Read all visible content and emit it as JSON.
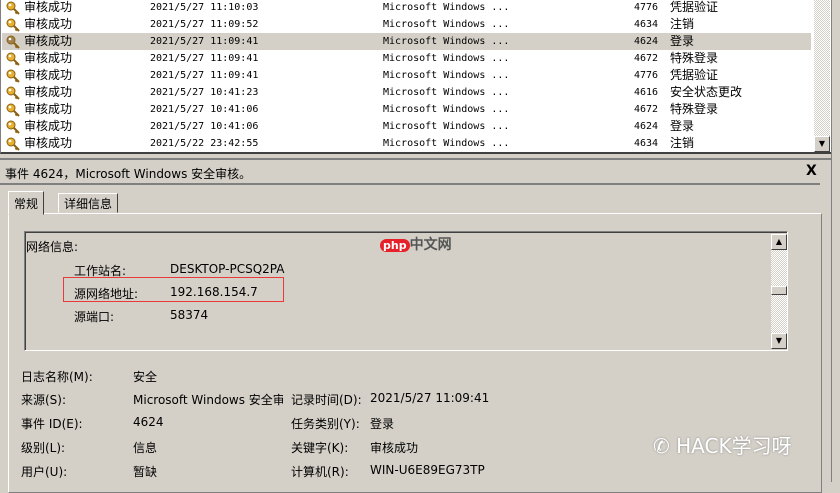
{
  "events": [
    {
      "level": "审核成功",
      "date": "2021/5/27 11:10:03",
      "source": "Microsoft Windows ...",
      "id": "4776",
      "task": "凭据验证"
    },
    {
      "level": "审核成功",
      "date": "2021/5/27 11:09:52",
      "source": "Microsoft Windows ...",
      "id": "4634",
      "task": "注销"
    },
    {
      "level": "审核成功",
      "date": "2021/5/27 11:09:41",
      "source": "Microsoft Windows ...",
      "id": "4624",
      "task": "登录"
    },
    {
      "level": "审核成功",
      "date": "2021/5/27 11:09:41",
      "source": "Microsoft Windows ...",
      "id": "4672",
      "task": "特殊登录"
    },
    {
      "level": "审核成功",
      "date": "2021/5/27 11:09:41",
      "source": "Microsoft Windows ...",
      "id": "4776",
      "task": "凭据验证"
    },
    {
      "level": "审核成功",
      "date": "2021/5/27 10:41:23",
      "source": "Microsoft Windows ...",
      "id": "4616",
      "task": "安全状态更改"
    },
    {
      "level": "审核成功",
      "date": "2021/5/27 10:41:06",
      "source": "Microsoft Windows ...",
      "id": "4672",
      "task": "特殊登录"
    },
    {
      "level": "审核成功",
      "date": "2021/5/27 10:41:06",
      "source": "Microsoft Windows ...",
      "id": "4624",
      "task": "登录"
    },
    {
      "level": "审核成功",
      "date": "2021/5/22 23:42:55",
      "source": "Microsoft Windows ...",
      "id": "4634",
      "task": "注销"
    }
  ],
  "detail": {
    "title": "事件 4624，Microsoft Windows 安全审核。",
    "close": "X",
    "tabs": [
      "常规",
      "详细信息"
    ],
    "network": {
      "heading": "网络信息:",
      "workstation_label": "工作站名:",
      "workstation": "DESKTOP-PCSQ2PA",
      "addr_label": "源网络地址:",
      "addr": "192.168.154.7",
      "port_label": "源端口:",
      "port": "58374"
    },
    "fields": {
      "log_label": "日志名称(M):",
      "log": "安全",
      "source_label": "来源(S):",
      "source": "Microsoft Windows 安全审",
      "logged_label": "记录时间(D):",
      "logged": "2021/5/27 11:09:41",
      "eventid_label": "事件 ID(E):",
      "eventid": "4624",
      "task_label": "任务类别(Y):",
      "task": "登录",
      "level_label": "级别(L):",
      "level": "信息",
      "keywords_label": "关键字(K):",
      "keywords": "审核成功",
      "user_label": "用户(U):",
      "user": "暂缺",
      "computer_label": "计算机(R):",
      "computer": "WIN-U6E89EG73TP"
    }
  },
  "watermarks": {
    "php": "php",
    "php_cn": "中文网",
    "wechat": "HACK学习呀"
  }
}
